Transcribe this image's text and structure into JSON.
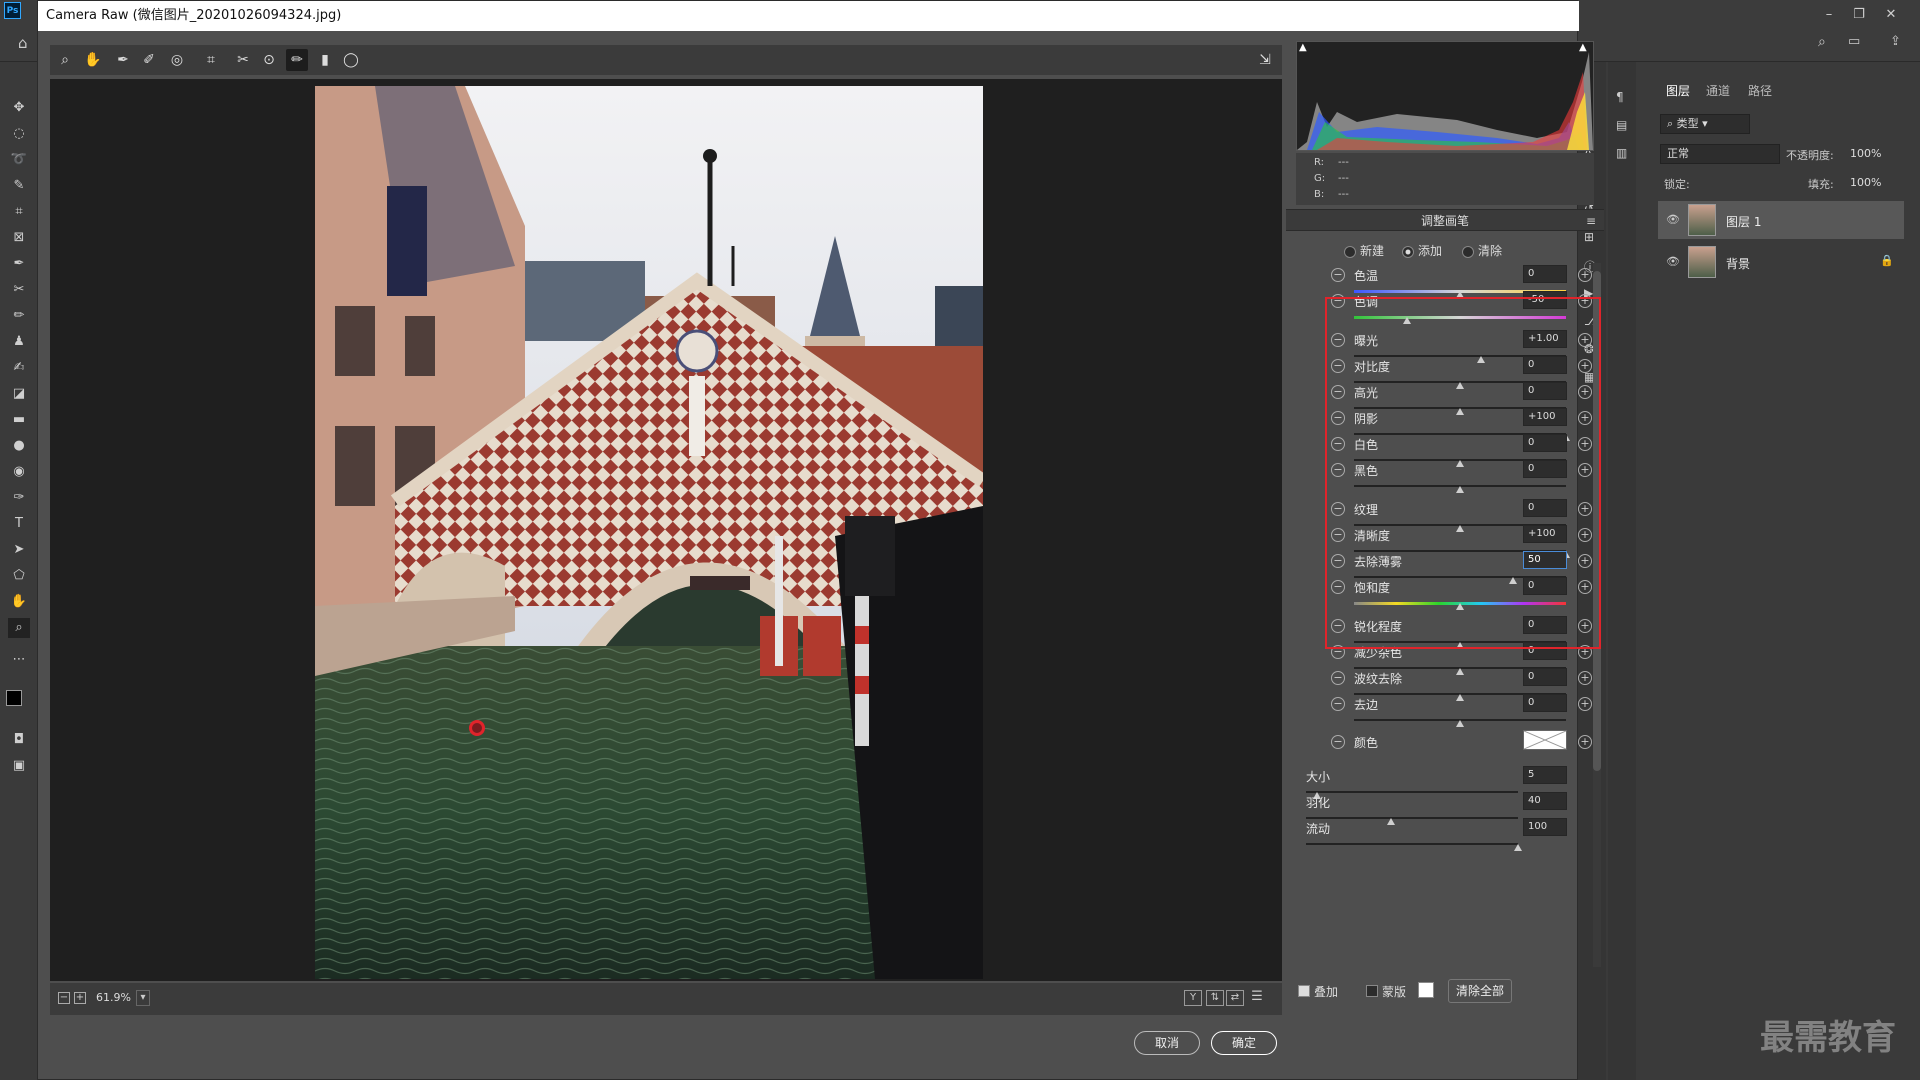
{
  "ps": {
    "logo": "Ps"
  },
  "dialog": {
    "title": "Camera Raw (微信图片_20201026094324.jpg)",
    "zoom": "61.9%",
    "cancel_label": "取消",
    "ok_label": "确定"
  },
  "panel": {
    "title": "调整画笔",
    "modes": [
      {
        "label": "新建",
        "selected": false
      },
      {
        "label": "添加",
        "selected": true
      },
      {
        "label": "清除",
        "selected": false
      }
    ],
    "rgb": {
      "r": "R:",
      "g": "G:",
      "b": "B:",
      "r_val": "---",
      "g_val": "---",
      "b_val": "---"
    },
    "sliders": [
      {
        "label": "色温",
        "value": "0",
        "level": 0.5,
        "track": "temp"
      },
      {
        "label": "色调",
        "value": "-50",
        "level": 0.25,
        "track": "tint"
      },
      {
        "label": "曝光",
        "value": "+1.00",
        "level": 0.6,
        "track": "plain"
      },
      {
        "label": "对比度",
        "value": "0",
        "level": 0.5,
        "track": "plain"
      },
      {
        "label": "高光",
        "value": "0",
        "level": 0.5,
        "track": "plain"
      },
      {
        "label": "阴影",
        "value": "+100",
        "level": 1.0,
        "track": "plain"
      },
      {
        "label": "白色",
        "value": "0",
        "level": 0.5,
        "track": "plain"
      },
      {
        "label": "黑色",
        "value": "0",
        "level": 0.5,
        "track": "plain"
      },
      {
        "label": "纹理",
        "value": "0",
        "level": 0.5,
        "track": "plain"
      },
      {
        "label": "清晰度",
        "value": "+100",
        "level": 1.0,
        "track": "plain"
      },
      {
        "label": "去除薄雾",
        "value": "50",
        "level": 0.75,
        "track": "plain",
        "editing": true
      },
      {
        "label": "饱和度",
        "value": "0",
        "level": 0.5,
        "track": "sat"
      },
      {
        "label": "锐化程度",
        "value": "0",
        "level": 0.5,
        "track": "plain"
      },
      {
        "label": "减少杂色",
        "value": "0",
        "level": 0.5,
        "track": "plain"
      },
      {
        "label": "波纹去除",
        "value": "0",
        "level": 0.5,
        "track": "plain"
      },
      {
        "label": "去边",
        "value": "0",
        "level": 0.5,
        "track": "plain"
      },
      {
        "label": "颜色",
        "value": "",
        "level": null,
        "track": "color"
      },
      {
        "label": "大小",
        "value": "5",
        "level": 0.05,
        "track": "plain"
      },
      {
        "label": "羽化",
        "value": "40",
        "level": 0.4,
        "track": "plain"
      },
      {
        "label": "流动",
        "value": "100",
        "level": 1.0,
        "track": "plain"
      }
    ],
    "overlay_label": "叠加",
    "overlay_checked": true,
    "mask_label": "蒙版",
    "mask_checked": false,
    "clear_all_label": "清除全部"
  },
  "layers_panel": {
    "tabs": [
      "图层",
      "通道",
      "路径"
    ],
    "filter": "类型",
    "blend_mode": "正常",
    "opacity_label": "不透明度:",
    "opacity_value": "100%",
    "lock_label": "锁定:",
    "fill_label": "填充:",
    "fill_value": "100%",
    "layers": [
      {
        "name": "图层 1",
        "locked": false
      },
      {
        "name": "背景",
        "locked": true
      }
    ]
  },
  "watermark": "最需教育",
  "colors": {
    "highlight": "#e0242b",
    "accent": "#4a8cd8"
  }
}
